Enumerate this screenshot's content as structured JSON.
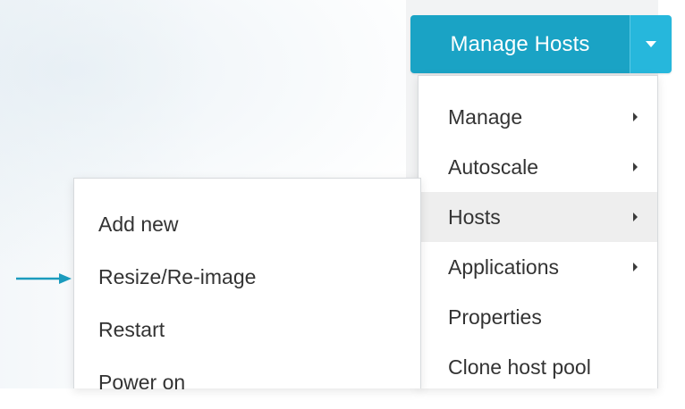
{
  "button": {
    "label": "Manage Hosts",
    "toggle_icon": "caret-down-icon",
    "main_color": "#1aa3c5",
    "toggle_color": "#26b7dc"
  },
  "menu": {
    "items": [
      {
        "label": "Manage",
        "has_submenu": true
      },
      {
        "label": "Autoscale",
        "has_submenu": true
      },
      {
        "label": "Hosts",
        "has_submenu": true,
        "active": true
      },
      {
        "label": "Applications",
        "has_submenu": true
      },
      {
        "label": "Properties",
        "has_submenu": false
      },
      {
        "label": "Clone host pool",
        "has_submenu": false
      }
    ]
  },
  "submenu": {
    "items": [
      {
        "label": "Add new"
      },
      {
        "label": "Resize/Re-image",
        "highlighted_by": "arrow-icon"
      },
      {
        "label": "Restart"
      },
      {
        "label": "Power on"
      }
    ]
  },
  "annotation": {
    "icon": "arrow-right-icon",
    "color": "#1b9bbd"
  }
}
